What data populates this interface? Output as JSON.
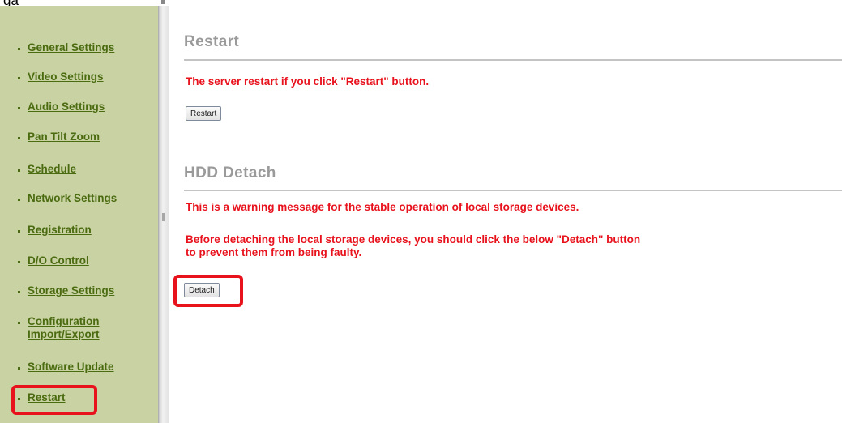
{
  "top_fragment": "ga",
  "sidebar": {
    "items": [
      {
        "label": "General Settings"
      },
      {
        "label": "Video Settings"
      },
      {
        "label": "Audio Settings"
      },
      {
        "label": "Pan Tilt Zoom"
      },
      {
        "label": "Schedule"
      },
      {
        "label": "Network Settings"
      },
      {
        "label": "Registration"
      },
      {
        "label": "D/O Control"
      },
      {
        "label": "Storage Settings"
      },
      {
        "label": "Configuration Import/Export"
      },
      {
        "label": "Software Update"
      },
      {
        "label": "Restart"
      }
    ]
  },
  "restart_section": {
    "title": "Restart",
    "message": "The server restart if you click \"Restart\" button.",
    "button_label": "Restart"
  },
  "hdd_section": {
    "title": "HDD Detach",
    "warning": "This is a warning message for the stable operation of local storage devices.",
    "instruction_line1": "Before detaching the local storage devices, you should click the below \"Detach\" button",
    "instruction_line2": "to prevent them from being faulty.",
    "button_label": "Detach"
  },
  "colors": {
    "sidebar_bg": "#c9d2a2",
    "nav_link": "#4a6b10",
    "warning_text": "#e8121d",
    "section_title": "#9a9a9a",
    "highlight_box": "#e8121d"
  }
}
